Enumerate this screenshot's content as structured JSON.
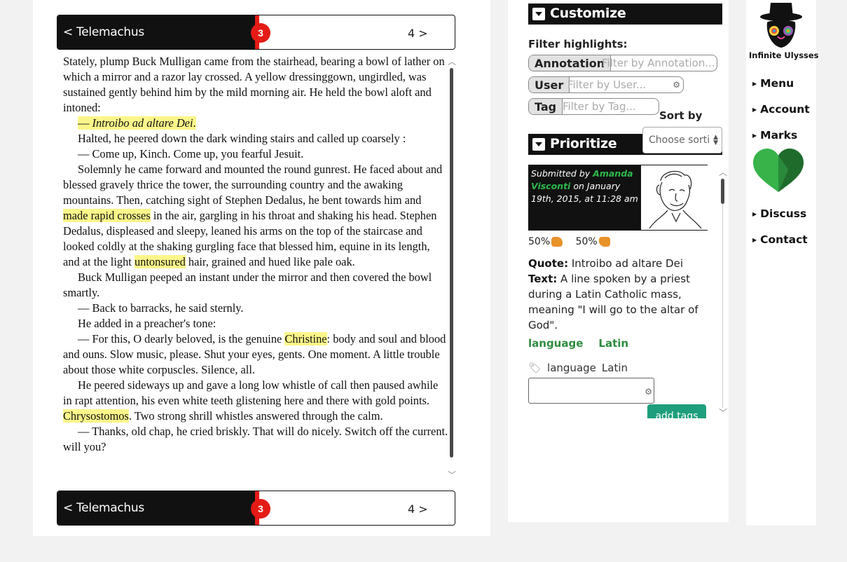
{
  "reader": {
    "chapter_prev": "< Telemachus",
    "chapter_badge": "3",
    "chapter_next": "4 >",
    "paragraphs": [
      {
        "indent": false,
        "segments": [
          {
            "t": "Stately, plump Buck Mulligan came from the stairhead, bearing a bowl of lather on which a mirror and a razor lay crossed. A yellow dressinggown, ungirdled, was sustained gently behind him by the mild morning air. He held the bowl aloft and intoned:"
          }
        ]
      },
      {
        "indent": true,
        "segments": [
          {
            "t": "— ",
            "h": "hl"
          },
          {
            "t": "Introibo ad altare Dei",
            "h": "hl-i"
          },
          {
            "t": ".",
            "h": "hl"
          }
        ]
      },
      {
        "indent": true,
        "segments": [
          {
            "t": "Halted, he peered down the dark winding stairs and called up coarsely :"
          }
        ]
      },
      {
        "indent": true,
        "segments": [
          {
            "t": "— Come up, Kinch. Come up, you fearful Jesuit."
          }
        ]
      },
      {
        "indent": true,
        "segments": [
          {
            "t": "Solemnly he came forward and mounted the round gunrest. He faced about and blessed gravely thrice the tower, the surrounding country and the awaking mountains. Then, catching sight of Stephen Dedalus, he bent towards him and "
          },
          {
            "t": "made rapid crosses",
            "h": "hl"
          },
          {
            "t": " in the air, gargling in his throat and shaking his head. Stephen Dedalus, displeased and sleepy, leaned his arms on the top of the staircase and looked coldly at the shaking gurgling face that blessed him, equine in its length, and at the light "
          },
          {
            "t": "untonsured",
            "h": "hl"
          },
          {
            "t": " hair, grained and hued like pale oak."
          }
        ]
      },
      {
        "indent": true,
        "segments": [
          {
            "t": "Buck Mulligan peeped an instant under the mirror and then covered the bowl smartly."
          }
        ]
      },
      {
        "indent": true,
        "segments": [
          {
            "t": "— Back to barracks, he said sternly."
          }
        ]
      },
      {
        "indent": true,
        "segments": [
          {
            "t": "He added in a preacher's tone:"
          }
        ]
      },
      {
        "indent": true,
        "segments": [
          {
            "t": "— For this, O dearly beloved, is the genuine "
          },
          {
            "t": "Christine",
            "h": "hl"
          },
          {
            "t": ": body and soul and blood and ouns. Slow music, please. Shut your eyes, gents. One moment. A little trouble about those white corpuscles. Silence, all."
          }
        ]
      },
      {
        "indent": true,
        "segments": [
          {
            "t": "He peered sideways up and gave a long low whistle of call then paused awhile in rapt attention, his even white teeth glistening here and there with gold points. "
          },
          {
            "t": "Chrysostomos",
            "h": "hl"
          },
          {
            "t": ". Two strong shrill whistles answered through the calm."
          }
        ]
      },
      {
        "indent": true,
        "segments": [
          {
            "t": "— Thanks, old chap, he cried briskly. That will do nicely. Switch off the current. will you?"
          }
        ]
      }
    ]
  },
  "panel": {
    "customize_title": "Customize",
    "filter_label": "Filter highlights:",
    "filters": [
      {
        "tag": "Annotation",
        "placeholder": "Filter by Annotation..."
      },
      {
        "tag": "User",
        "placeholder": "Filter by User..."
      },
      {
        "tag": "Tag",
        "placeholder": "Filter by Tag..."
      }
    ],
    "sort_label": "Sort by",
    "sort_value": "Choose sorti",
    "prioritize_title": "Prioritize",
    "annotation": {
      "submitted_prefix": "Submitted by ",
      "author": "Amanda Visconti",
      "submitted_suffix": " on January 19th, 2015, at 11:28 am",
      "vote_up": "50%",
      "vote_down": "50%",
      "quote_label": "Quote:",
      "quote": " Introibo ad altare Dei",
      "text_label": "Text:",
      "text": " A line spoken by a priest during a Latin Catholic mass, meaning \"I will go to the altar of God\".",
      "categories": [
        "language",
        "Latin"
      ],
      "tags": [
        "language",
        "Latin"
      ],
      "add_tags_label": "add tags"
    }
  },
  "nav": {
    "logo_caption": "Infinite Ulysses",
    "items": [
      "Menu",
      "Account",
      "Marks",
      "Discuss",
      "Contact"
    ]
  },
  "colors": {
    "highlight": "#fbf68a",
    "accent_red": "#e41b17",
    "green": "#2e8b3f",
    "button_teal": "#1e9e7c"
  }
}
